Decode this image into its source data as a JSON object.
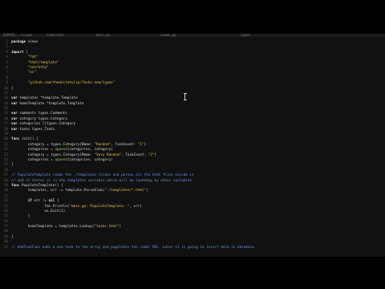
{
  "tabs": [
    "GOPATH.../views",
    "templates",
    "main.go",
    "views.go",
    "types"
  ],
  "code": [
    {
      "n": "1",
      "segs": [
        {
          "c": "kw",
          "t": "package"
        },
        {
          "c": "txt",
          "t": " views"
        }
      ]
    },
    {
      "n": "2",
      "segs": []
    },
    {
      "n": "3",
      "segs": [
        {
          "c": "kw",
          "t": "import"
        },
        {
          "c": "txt",
          "t": " ("
        }
      ]
    },
    {
      "n": "4",
      "segs": [
        {
          "c": "txt",
          "t": "        "
        },
        {
          "c": "str",
          "t": "\"fmt\""
        }
      ]
    },
    {
      "n": "5",
      "segs": [
        {
          "c": "txt",
          "t": "        "
        },
        {
          "c": "str",
          "t": "\"html/template\""
        }
      ]
    },
    {
      "n": "6",
      "segs": [
        {
          "c": "txt",
          "t": "        "
        },
        {
          "c": "str",
          "t": "\"net/http\""
        }
      ]
    },
    {
      "n": "7",
      "segs": [
        {
          "c": "txt",
          "t": "        "
        },
        {
          "c": "str",
          "t": "\"os\""
        }
      ]
    },
    {
      "n": "8",
      "segs": []
    },
    {
      "n": "9",
      "segs": [
        {
          "c": "txt",
          "t": "        "
        },
        {
          "c": "str",
          "t": "\"github.com/thewhitetulip/Tasks-new/types\""
        }
      ]
    },
    {
      "n": "10",
      "segs": [
        {
          "c": "txt",
          "t": ")"
        }
      ]
    },
    {
      "n": "11",
      "segs": []
    },
    {
      "n": "12",
      "segs": [
        {
          "c": "kw",
          "t": "var"
        },
        {
          "c": "txt",
          "t": " templates *template.Template"
        }
      ]
    },
    {
      "n": "13",
      "segs": [
        {
          "c": "kw",
          "t": "var"
        },
        {
          "c": "txt",
          "t": " homeTemplate *template.Template"
        }
      ]
    },
    {
      "n": "14",
      "segs": []
    },
    {
      "n": "15",
      "segs": [
        {
          "c": "kw",
          "t": "var"
        },
        {
          "c": "txt",
          "t": " comments types.Comments"
        }
      ]
    },
    {
      "n": "16",
      "segs": [
        {
          "c": "kw",
          "t": "var"
        },
        {
          "c": "txt",
          "t": " category types.Category"
        }
      ]
    },
    {
      "n": "17",
      "segs": [
        {
          "c": "kw",
          "t": "var"
        },
        {
          "c": "txt",
          "t": " categories []types.Category"
        }
      ]
    },
    {
      "n": "18",
      "segs": [
        {
          "c": "kw",
          "t": "var"
        },
        {
          "c": "txt",
          "t": " tasks types.Tasks"
        }
      ]
    },
    {
      "n": "19",
      "segs": []
    },
    {
      "n": "20",
      "segs": [
        {
          "c": "kw",
          "t": "func"
        },
        {
          "c": "txt",
          "t": " init() {"
        }
      ]
    },
    {
      "n": "21",
      "segs": [
        {
          "c": "txt",
          "t": "        category = types.Category{Name: "
        },
        {
          "c": "str",
          "t": "\"Random\""
        },
        {
          "c": "txt",
          "t": ", TaskCount: "
        },
        {
          "c": "str",
          "t": "\"1\""
        },
        {
          "c": "txt",
          "t": "}"
        }
      ]
    },
    {
      "n": "22",
      "segs": [
        {
          "c": "txt",
          "t": "        categories = "
        },
        {
          "c": "fn",
          "t": "append"
        },
        {
          "c": "txt",
          "t": "(categories, category)"
        }
      ]
    },
    {
      "n": "23",
      "segs": [
        {
          "c": "txt",
          "t": "        category = types.Category{Name: "
        },
        {
          "c": "str",
          "t": "\"Very Random\""
        },
        {
          "c": "txt",
          "t": ", TaskCount: "
        },
        {
          "c": "str",
          "t": "\"2\""
        },
        {
          "c": "txt",
          "t": "}"
        }
      ]
    },
    {
      "n": "24",
      "segs": [
        {
          "c": "txt",
          "t": "        categories = "
        },
        {
          "c": "fn",
          "t": "append"
        },
        {
          "c": "txt",
          "t": "(categories, category)"
        }
      ]
    },
    {
      "n": "25",
      "segs": [
        {
          "c": "txt",
          "t": "}"
        }
      ]
    },
    {
      "n": "26",
      "segs": []
    },
    {
      "n": "27",
      "segs": [
        {
          "c": "cmt",
          "t": "// PopulateTemplate reads the ./templates folder and parses all the html files inside it"
        }
      ]
    },
    {
      "n": "28",
      "segs": [
        {
          "c": "cmt",
          "t": "// and it stores it in the templates variable which will be lookedup by other variables."
        }
      ]
    },
    {
      "n": "29",
      "segs": [
        {
          "c": "kw",
          "t": "func"
        },
        {
          "c": "txt",
          "t": " PopulateTemplate() {"
        }
      ]
    },
    {
      "n": "30",
      "segs": [
        {
          "c": "txt",
          "t": "        templates, err := template.ParseGlob("
        },
        {
          "c": "str",
          "t": "\"./templates/*.html\""
        },
        {
          "c": "txt",
          "t": ")"
        }
      ]
    },
    {
      "n": "31",
      "segs": []
    },
    {
      "n": "32",
      "segs": [
        {
          "c": "txt",
          "t": "        "
        },
        {
          "c": "kw",
          "t": "if"
        },
        {
          "c": "txt",
          "t": " err != "
        },
        {
          "c": "kw",
          "t": "nil"
        },
        {
          "c": "txt",
          "t": " {"
        }
      ]
    },
    {
      "n": "33",
      "segs": [
        {
          "c": "txt",
          "t": "                fmt.Println("
        },
        {
          "c": "str",
          "t": "\"main.go: PopulateTemplate: \""
        },
        {
          "c": "txt",
          "t": ", err)"
        }
      ]
    },
    {
      "n": "34",
      "segs": [
        {
          "c": "txt",
          "t": "                os.Exit(1)"
        }
      ]
    },
    {
      "n": "35",
      "segs": [
        {
          "c": "txt",
          "t": "        }"
        }
      ]
    },
    {
      "n": "36",
      "segs": []
    },
    {
      "n": "37",
      "segs": [
        {
          "c": "txt",
          "t": "        homeTemplate = templates.Lookup("
        },
        {
          "c": "str",
          "t": "\"tasks.html\""
        },
        {
          "c": "txt",
          "t": ")"
        }
      ]
    },
    {
      "n": "38",
      "segs": []
    },
    {
      "n": "39",
      "segs": [
        {
          "c": "txt",
          "t": "}"
        }
      ]
    },
    {
      "n": "40",
      "segs": []
    },
    {
      "n": "41",
      "segs": [
        {
          "c": "cmt",
          "t": "// AddTaskFunc adds a new task to the array and populates the /add/ URL. Later it is going to insert data in database."
        }
      ]
    }
  ]
}
